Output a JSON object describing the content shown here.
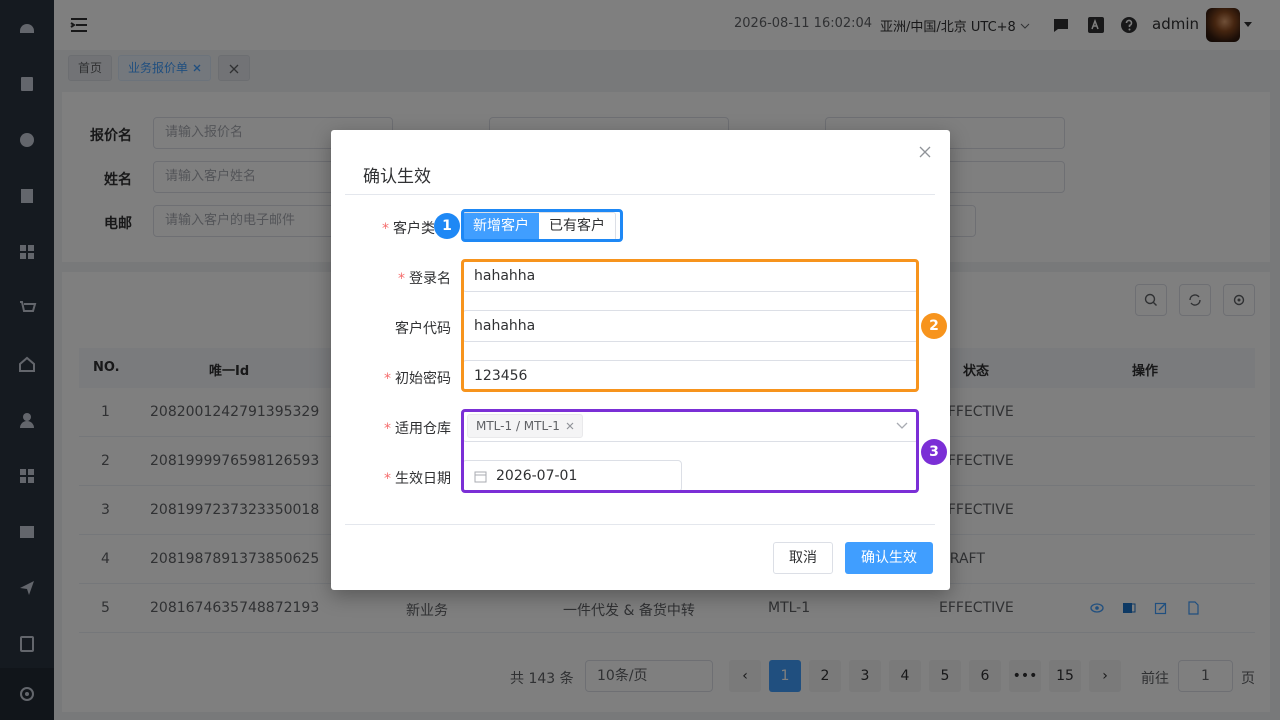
{
  "header": {
    "datetime": "2026-08-11 16:02:04",
    "timezone": "亚洲/中国/北京 UTC+8",
    "username": "admin"
  },
  "tabs": [
    {
      "label": "首页"
    },
    {
      "label": "业务报价单"
    }
  ],
  "search": {
    "fields": [
      {
        "label": "报价名",
        "placeholder": "请输入报价名"
      },
      {
        "label": "姓名",
        "placeholder": "请输入客户姓名"
      },
      {
        "label": "电邮",
        "placeholder": "请输入客户的电子邮件"
      }
    ]
  },
  "table": {
    "columns": {
      "no": "NO.",
      "id": "唯一Id",
      "status": "状态",
      "ops": "操作"
    },
    "rows": [
      {
        "no": "1",
        "id": "2082001242791395329",
        "status": "EFFECTIVE"
      },
      {
        "no": "2",
        "id": "2081999976598126593",
        "status": "EFFECTIVE"
      },
      {
        "no": "3",
        "id": "2081997237323350018",
        "status": "EFFECTIVE"
      },
      {
        "no": "4",
        "id": "2081987891373850625",
        "status": "DRAFT"
      },
      {
        "no": "5",
        "id": "2081674635748872193",
        "type": "新业务",
        "mode": "一件代发 & 备货中转",
        "warehouse": "MTL-1",
        "status": "EFFECTIVE"
      }
    ]
  },
  "pagination": {
    "total": "共 143 条",
    "page_size": "10条/页",
    "pages": [
      "1",
      "2",
      "3",
      "4",
      "5",
      "6",
      "•••",
      "15"
    ],
    "current": "1",
    "goto_label": "前往",
    "goto_value": "1",
    "page_suffix": "页"
  },
  "dialog": {
    "title": "确认生效",
    "customer_type": {
      "label": "客户类",
      "options": [
        "新增客户",
        "已有客户"
      ],
      "selected": "新增客户"
    },
    "login": {
      "label": "登录名",
      "value": "hahahha"
    },
    "code": {
      "label": "客户代码",
      "value": "hahahha"
    },
    "password": {
      "label": "初始密码",
      "value": "123456"
    },
    "warehouse": {
      "label": "适用仓库",
      "tag": "MTL-1 / MTL-1"
    },
    "date": {
      "label": "生效日期",
      "value": "2026-07-01"
    },
    "cancel": "取消",
    "confirm": "确认生效"
  },
  "annotations": [
    {
      "number": "1",
      "color": "#1e88f5"
    },
    {
      "number": "2",
      "color": "#f7941d"
    },
    {
      "number": "3",
      "color": "#7b2fd6"
    }
  ]
}
